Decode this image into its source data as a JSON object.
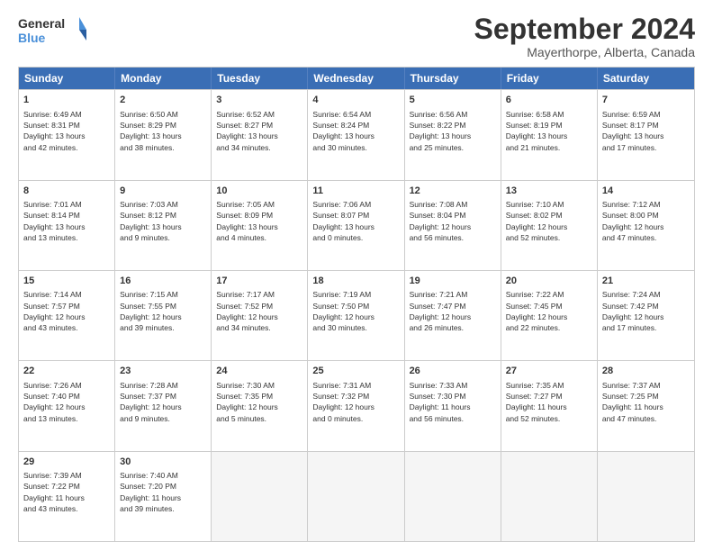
{
  "header": {
    "logo_line1": "General",
    "logo_line2": "Blue",
    "title": "September 2024",
    "subtitle": "Mayerthorpe, Alberta, Canada"
  },
  "calendar": {
    "days": [
      "Sunday",
      "Monday",
      "Tuesday",
      "Wednesday",
      "Thursday",
      "Friday",
      "Saturday"
    ],
    "rows": [
      [
        {
          "num": "1",
          "lines": [
            "Sunrise: 6:49 AM",
            "Sunset: 8:31 PM",
            "Daylight: 13 hours",
            "and 42 minutes."
          ]
        },
        {
          "num": "2",
          "lines": [
            "Sunrise: 6:50 AM",
            "Sunset: 8:29 PM",
            "Daylight: 13 hours",
            "and 38 minutes."
          ]
        },
        {
          "num": "3",
          "lines": [
            "Sunrise: 6:52 AM",
            "Sunset: 8:27 PM",
            "Daylight: 13 hours",
            "and 34 minutes."
          ]
        },
        {
          "num": "4",
          "lines": [
            "Sunrise: 6:54 AM",
            "Sunset: 8:24 PM",
            "Daylight: 13 hours",
            "and 30 minutes."
          ]
        },
        {
          "num": "5",
          "lines": [
            "Sunrise: 6:56 AM",
            "Sunset: 8:22 PM",
            "Daylight: 13 hours",
            "and 25 minutes."
          ]
        },
        {
          "num": "6",
          "lines": [
            "Sunrise: 6:58 AM",
            "Sunset: 8:19 PM",
            "Daylight: 13 hours",
            "and 21 minutes."
          ]
        },
        {
          "num": "7",
          "lines": [
            "Sunrise: 6:59 AM",
            "Sunset: 8:17 PM",
            "Daylight: 13 hours",
            "and 17 minutes."
          ]
        }
      ],
      [
        {
          "num": "8",
          "lines": [
            "Sunrise: 7:01 AM",
            "Sunset: 8:14 PM",
            "Daylight: 13 hours",
            "and 13 minutes."
          ]
        },
        {
          "num": "9",
          "lines": [
            "Sunrise: 7:03 AM",
            "Sunset: 8:12 PM",
            "Daylight: 13 hours",
            "and 9 minutes."
          ]
        },
        {
          "num": "10",
          "lines": [
            "Sunrise: 7:05 AM",
            "Sunset: 8:09 PM",
            "Daylight: 13 hours",
            "and 4 minutes."
          ]
        },
        {
          "num": "11",
          "lines": [
            "Sunrise: 7:06 AM",
            "Sunset: 8:07 PM",
            "Daylight: 13 hours",
            "and 0 minutes."
          ]
        },
        {
          "num": "12",
          "lines": [
            "Sunrise: 7:08 AM",
            "Sunset: 8:04 PM",
            "Daylight: 12 hours",
            "and 56 minutes."
          ]
        },
        {
          "num": "13",
          "lines": [
            "Sunrise: 7:10 AM",
            "Sunset: 8:02 PM",
            "Daylight: 12 hours",
            "and 52 minutes."
          ]
        },
        {
          "num": "14",
          "lines": [
            "Sunrise: 7:12 AM",
            "Sunset: 8:00 PM",
            "Daylight: 12 hours",
            "and 47 minutes."
          ]
        }
      ],
      [
        {
          "num": "15",
          "lines": [
            "Sunrise: 7:14 AM",
            "Sunset: 7:57 PM",
            "Daylight: 12 hours",
            "and 43 minutes."
          ]
        },
        {
          "num": "16",
          "lines": [
            "Sunrise: 7:15 AM",
            "Sunset: 7:55 PM",
            "Daylight: 12 hours",
            "and 39 minutes."
          ]
        },
        {
          "num": "17",
          "lines": [
            "Sunrise: 7:17 AM",
            "Sunset: 7:52 PM",
            "Daylight: 12 hours",
            "and 34 minutes."
          ]
        },
        {
          "num": "18",
          "lines": [
            "Sunrise: 7:19 AM",
            "Sunset: 7:50 PM",
            "Daylight: 12 hours",
            "and 30 minutes."
          ]
        },
        {
          "num": "19",
          "lines": [
            "Sunrise: 7:21 AM",
            "Sunset: 7:47 PM",
            "Daylight: 12 hours",
            "and 26 minutes."
          ]
        },
        {
          "num": "20",
          "lines": [
            "Sunrise: 7:22 AM",
            "Sunset: 7:45 PM",
            "Daylight: 12 hours",
            "and 22 minutes."
          ]
        },
        {
          "num": "21",
          "lines": [
            "Sunrise: 7:24 AM",
            "Sunset: 7:42 PM",
            "Daylight: 12 hours",
            "and 17 minutes."
          ]
        }
      ],
      [
        {
          "num": "22",
          "lines": [
            "Sunrise: 7:26 AM",
            "Sunset: 7:40 PM",
            "Daylight: 12 hours",
            "and 13 minutes."
          ]
        },
        {
          "num": "23",
          "lines": [
            "Sunrise: 7:28 AM",
            "Sunset: 7:37 PM",
            "Daylight: 12 hours",
            "and 9 minutes."
          ]
        },
        {
          "num": "24",
          "lines": [
            "Sunrise: 7:30 AM",
            "Sunset: 7:35 PM",
            "Daylight: 12 hours",
            "and 5 minutes."
          ]
        },
        {
          "num": "25",
          "lines": [
            "Sunrise: 7:31 AM",
            "Sunset: 7:32 PM",
            "Daylight: 12 hours",
            "and 0 minutes."
          ]
        },
        {
          "num": "26",
          "lines": [
            "Sunrise: 7:33 AM",
            "Sunset: 7:30 PM",
            "Daylight: 11 hours",
            "and 56 minutes."
          ]
        },
        {
          "num": "27",
          "lines": [
            "Sunrise: 7:35 AM",
            "Sunset: 7:27 PM",
            "Daylight: 11 hours",
            "and 52 minutes."
          ]
        },
        {
          "num": "28",
          "lines": [
            "Sunrise: 7:37 AM",
            "Sunset: 7:25 PM",
            "Daylight: 11 hours",
            "and 47 minutes."
          ]
        }
      ],
      [
        {
          "num": "29",
          "lines": [
            "Sunrise: 7:39 AM",
            "Sunset: 7:22 PM",
            "Daylight: 11 hours",
            "and 43 minutes."
          ]
        },
        {
          "num": "30",
          "lines": [
            "Sunrise: 7:40 AM",
            "Sunset: 7:20 PM",
            "Daylight: 11 hours",
            "and 39 minutes."
          ]
        },
        {
          "num": "",
          "lines": []
        },
        {
          "num": "",
          "lines": []
        },
        {
          "num": "",
          "lines": []
        },
        {
          "num": "",
          "lines": []
        },
        {
          "num": "",
          "lines": []
        }
      ]
    ]
  }
}
